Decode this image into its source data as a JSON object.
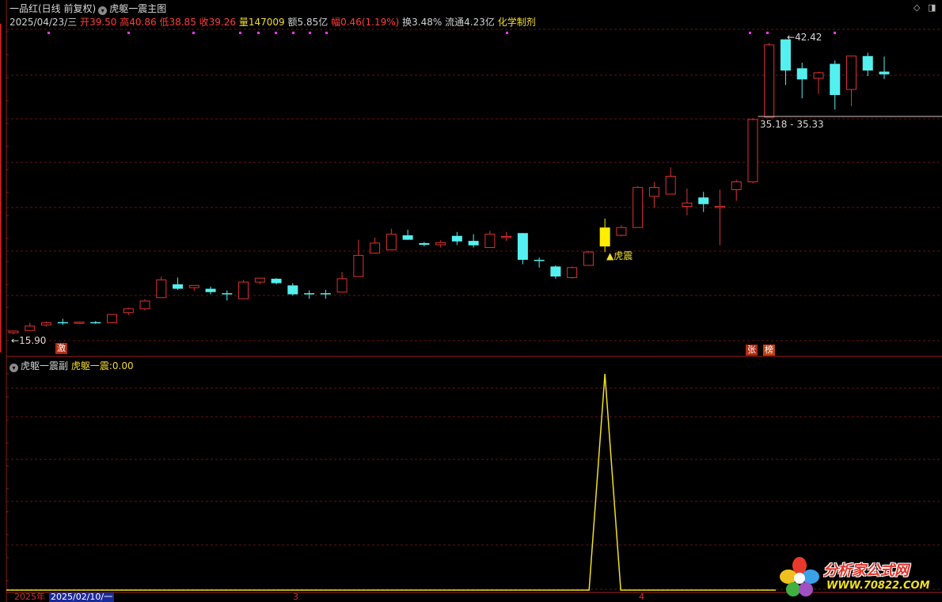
{
  "header": {
    "title": "一品红(日线 前复权)",
    "indicator_main": "虎躯一震主图",
    "window_icons": [
      "◇",
      "◨"
    ]
  },
  "info": {
    "date": "2025/04/23/三",
    "open_label": "开",
    "open": "39.50",
    "high_label": "高",
    "high": "40.86",
    "low_label": "低",
    "low": "38.85",
    "close_label": "收",
    "close": "39.26",
    "volume_label": "量",
    "volume": "147009",
    "amount_label": "额",
    "amount": "5.85亿",
    "change_label": "幅",
    "change": "0.46(1.19%)",
    "turnover_label": "换",
    "turnover": "3.48%",
    "float_label": "流通",
    "float": "4.23亿",
    "sector": "化学制剂"
  },
  "annotations": {
    "high_price": "42.42",
    "low_price": "15.90",
    "gap_range": "35.18 - 35.33",
    "signal": "▲虎震",
    "badge_left": "激",
    "badge_right_1": "张",
    "badge_right_2": "榜"
  },
  "sub_panel": {
    "title": "虎躯一震副",
    "value_label": "虎躯一震:",
    "value": "0.00"
  },
  "date_bar": {
    "year": "2025年",
    "current": "2025/02/10/一",
    "mark_3": "3",
    "mark_4": "4"
  },
  "logo": {
    "name": "分析家公式网",
    "url": "WWW.70822.COM"
  },
  "colors": {
    "up": "#e03030",
    "down": "#54f0f0",
    "signal": "#ffee00",
    "grid": "#6a1010"
  },
  "chart_data": {
    "type": "candlestick",
    "ylim_main": [
      15.2,
      43.8
    ],
    "candles": [
      {
        "o": 16.05,
        "h": 16.25,
        "l": 15.9,
        "c": 16.2,
        "d": "u"
      },
      {
        "o": 16.25,
        "h": 16.95,
        "l": 16.2,
        "c": 16.65,
        "d": "u"
      },
      {
        "o": 16.75,
        "h": 17.05,
        "l": 16.6,
        "c": 16.95,
        "d": "u"
      },
      {
        "o": 17.0,
        "h": 17.3,
        "l": 16.75,
        "c": 16.95,
        "d": "d"
      },
      {
        "o": 16.95,
        "h": 17.05,
        "l": 16.85,
        "c": 17.0,
        "d": "u"
      },
      {
        "o": 17.0,
        "h": 17.1,
        "l": 16.85,
        "c": 16.95,
        "d": "d"
      },
      {
        "o": 16.95,
        "h": 17.7,
        "l": 16.95,
        "c": 17.7,
        "d": "u"
      },
      {
        "o": 17.85,
        "h": 18.3,
        "l": 17.65,
        "c": 18.2,
        "d": "u"
      },
      {
        "o": 18.2,
        "h": 19.05,
        "l": 18.05,
        "c": 18.9,
        "d": "u"
      },
      {
        "o": 19.2,
        "h": 21.1,
        "l": 19.2,
        "c": 20.8,
        "d": "u"
      },
      {
        "o": 20.4,
        "h": 21.0,
        "l": 19.9,
        "c": 20.0,
        "d": "d"
      },
      {
        "o": 20.1,
        "h": 20.3,
        "l": 19.8,
        "c": 20.3,
        "d": "u"
      },
      {
        "o": 20.0,
        "h": 20.2,
        "l": 19.5,
        "c": 19.7,
        "d": "d"
      },
      {
        "o": 19.55,
        "h": 19.85,
        "l": 18.95,
        "c": 19.6,
        "d": "d"
      },
      {
        "o": 19.1,
        "h": 20.8,
        "l": 19.1,
        "c": 20.6,
        "d": "u"
      },
      {
        "o": 20.6,
        "h": 21.0,
        "l": 20.4,
        "c": 20.95,
        "d": "u"
      },
      {
        "o": 20.9,
        "h": 20.95,
        "l": 20.4,
        "c": 20.5,
        "d": "d"
      },
      {
        "o": 20.3,
        "h": 20.5,
        "l": 19.4,
        "c": 19.5,
        "d": "d"
      },
      {
        "o": 19.6,
        "h": 19.85,
        "l": 19.1,
        "c": 19.6,
        "d": "d"
      },
      {
        "o": 19.6,
        "h": 19.9,
        "l": 19.1,
        "c": 19.55,
        "d": "d"
      },
      {
        "o": 19.7,
        "h": 21.5,
        "l": 19.7,
        "c": 20.9,
        "d": "u"
      },
      {
        "o": 21.1,
        "h": 24.4,
        "l": 21.1,
        "c": 23.0,
        "d": "u"
      },
      {
        "o": 23.2,
        "h": 24.6,
        "l": 23.2,
        "c": 24.1,
        "d": "u"
      },
      {
        "o": 23.5,
        "h": 25.4,
        "l": 23.5,
        "c": 24.9,
        "d": "u"
      },
      {
        "o": 24.8,
        "h": 25.3,
        "l": 24.4,
        "c": 24.4,
        "d": "d"
      },
      {
        "o": 24.1,
        "h": 24.2,
        "l": 23.8,
        "c": 23.95,
        "d": "d"
      },
      {
        "o": 23.95,
        "h": 24.35,
        "l": 23.7,
        "c": 24.15,
        "d": "u"
      },
      {
        "o": 24.75,
        "h": 25.1,
        "l": 23.95,
        "c": 24.25,
        "d": "d"
      },
      {
        "o": 24.3,
        "h": 24.9,
        "l": 23.7,
        "c": 23.9,
        "d": "d"
      },
      {
        "o": 23.7,
        "h": 25.2,
        "l": 23.7,
        "c": 24.9,
        "d": "u"
      },
      {
        "o": 24.7,
        "h": 25.1,
        "l": 24.3,
        "c": 24.7,
        "d": "u"
      },
      {
        "o": 25.0,
        "h": 25.0,
        "l": 22.2,
        "c": 22.6,
        "d": "d"
      },
      {
        "o": 22.6,
        "h": 22.8,
        "l": 21.9,
        "c": 22.5,
        "d": "d"
      },
      {
        "o": 22.0,
        "h": 22.1,
        "l": 20.9,
        "c": 21.1,
        "d": "d"
      },
      {
        "o": 21.0,
        "h": 22.0,
        "l": 20.9,
        "c": 21.9,
        "d": "u"
      },
      {
        "o": 22.1,
        "h": 23.4,
        "l": 22.1,
        "c": 23.3,
        "d": "u"
      },
      {
        "o": 23.8,
        "h": 26.3,
        "l": 23.3,
        "c": 25.5,
        "d": "y"
      },
      {
        "o": 24.8,
        "h": 25.7,
        "l": 24.7,
        "c": 25.5,
        "d": "u"
      },
      {
        "o": 25.5,
        "h": 29.2,
        "l": 25.5,
        "c": 29.1,
        "d": "u"
      },
      {
        "o": 28.3,
        "h": 29.6,
        "l": 27.3,
        "c": 29.1,
        "d": "u"
      },
      {
        "o": 28.5,
        "h": 30.9,
        "l": 28.5,
        "c": 30.1,
        "d": "u"
      },
      {
        "o": 27.4,
        "h": 29.0,
        "l": 26.6,
        "c": 27.7,
        "d": "u"
      },
      {
        "o": 28.2,
        "h": 28.7,
        "l": 26.9,
        "c": 27.6,
        "d": "d"
      },
      {
        "o": 27.4,
        "h": 28.9,
        "l": 23.9,
        "c": 27.4,
        "d": "u"
      },
      {
        "o": 28.9,
        "h": 29.8,
        "l": 27.9,
        "c": 29.6,
        "d": "u"
      },
      {
        "o": 29.6,
        "h": 35.3,
        "l": 29.5,
        "c": 35.2,
        "d": "u"
      },
      {
        "o": 35.4,
        "h": 42.1,
        "l": 35.4,
        "c": 41.9,
        "d": "u"
      },
      {
        "o": 42.4,
        "h": 42.42,
        "l": 38.3,
        "c": 39.6,
        "d": "d"
      },
      {
        "o": 39.8,
        "h": 40.3,
        "l": 37.1,
        "c": 38.8,
        "d": "d"
      },
      {
        "o": 38.9,
        "h": 39.5,
        "l": 37.5,
        "c": 39.4,
        "d": "u"
      },
      {
        "o": 40.2,
        "h": 40.5,
        "l": 36.1,
        "c": 37.4,
        "d": "d"
      },
      {
        "o": 37.9,
        "h": 40.9,
        "l": 36.4,
        "c": 40.9,
        "d": "u"
      },
      {
        "o": 40.9,
        "h": 41.2,
        "l": 39.1,
        "c": 39.6,
        "d": "d"
      },
      {
        "o": 39.5,
        "h": 40.86,
        "l": 38.85,
        "c": 39.26,
        "d": "d"
      }
    ],
    "sub_series": {
      "name": "虎躯一震",
      "values": [
        0,
        0,
        0,
        0,
        0,
        0,
        0,
        0,
        0,
        0,
        0,
        0,
        0,
        0,
        0,
        0,
        0,
        0,
        0,
        0,
        0,
        0,
        0,
        0,
        0,
        0,
        0,
        0,
        0,
        0,
        0,
        0,
        0,
        0,
        0,
        0,
        1,
        0,
        0,
        0,
        0,
        0,
        0,
        0,
        0,
        0,
        0,
        0,
        0,
        0,
        0,
        0,
        0,
        0
      ]
    }
  }
}
